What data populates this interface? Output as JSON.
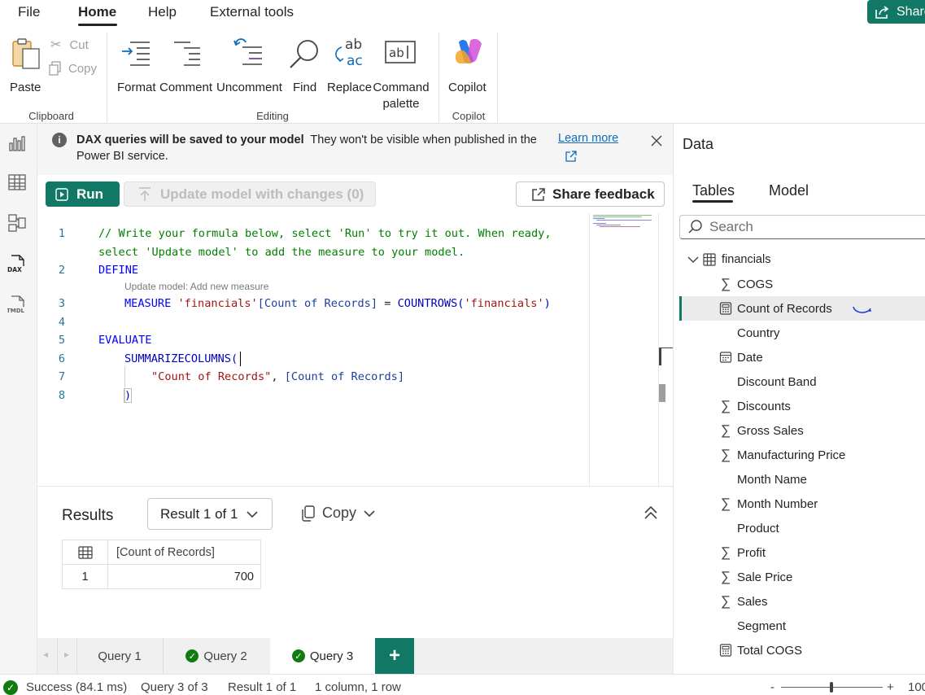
{
  "menu": {
    "tabs": [
      "File",
      "Home",
      "Help",
      "External tools"
    ],
    "share": "Share"
  },
  "ribbon": {
    "paste": "Paste",
    "cut": "Cut",
    "copy": "Copy",
    "clipboard_group": "Clipboard",
    "format": "Format",
    "comment": "Comment",
    "uncomment": "Uncomment",
    "find": "Find",
    "replace": "Replace",
    "command_palette_1": "Command",
    "command_palette_2": "palette",
    "editing_group": "Editing",
    "copilot": "Copilot",
    "copilot_group": "Copilot"
  },
  "banner": {
    "bold": "DAX queries will be saved to your model",
    "text": "They won't be visible when published in the Power BI service.",
    "learn_more": "Learn more"
  },
  "toolbar": {
    "run": "Run",
    "update": "Update model with changes (0)",
    "feedback": "Share feedback"
  },
  "editor": {
    "line_numbers": [
      "1",
      "2",
      "3",
      "4",
      "5",
      "6",
      "7",
      "8"
    ],
    "comment_1": "// Write your formula below, select 'Run' to try it out. When ready,",
    "comment_2": "select 'Update model' to add the measure to your model.",
    "define": "DEFINE",
    "hint": "Update model: Add new measure",
    "measure_kw": "MEASURE",
    "measure_table": "'financials'",
    "measure_name": "[Count of Records]",
    "measure_eq": " = ",
    "measure_fn": "COUNTROWS(",
    "measure_arg": "'financials'",
    "measure_close": ")",
    "evaluate": "EVALUATE",
    "summarize": "SUMMARIZECOLUMNS(",
    "string": "\"Count of Records\"",
    "comma": ", ",
    "ref": "[Count of Records]",
    "close": ")"
  },
  "results": {
    "title": "Results",
    "selector": "Result 1 of 1",
    "copy": "Copy",
    "column": "[Count of Records]",
    "rows": [
      {
        "num": "1",
        "value": "700"
      }
    ]
  },
  "query_tabs": {
    "q1": "Query 1",
    "q2": "Query 2",
    "q3": "Query 3",
    "add": "+"
  },
  "status": {
    "success": "Success (84.1 ms)",
    "query": "Query 3 of 3",
    "result": "Result 1 of 1",
    "shape": "1 column, 1 row",
    "zoom_minus": "-",
    "zoom_plus": "+",
    "zoom": "100"
  },
  "data_pane": {
    "title": "Data",
    "tab_tables": "Tables",
    "tab_model": "Model",
    "search_placeholder": "Search",
    "table_name": "financials",
    "fields": [
      {
        "label": "COGS",
        "icon": "sigma"
      },
      {
        "label": "Count of Records",
        "icon": "calculator"
      },
      {
        "label": "Country",
        "icon": ""
      },
      {
        "label": "Date",
        "icon": "calendar"
      },
      {
        "label": "Discount Band",
        "icon": ""
      },
      {
        "label": "Discounts",
        "icon": "sigma"
      },
      {
        "label": "Gross Sales",
        "icon": "sigma"
      },
      {
        "label": "Manufacturing Price",
        "icon": "sigma"
      },
      {
        "label": "Month Name",
        "icon": ""
      },
      {
        "label": "Month Number",
        "icon": "sigma"
      },
      {
        "label": "Product",
        "icon": ""
      },
      {
        "label": "Profit",
        "icon": "sigma"
      },
      {
        "label": "Sale Price",
        "icon": "sigma"
      },
      {
        "label": "Sales",
        "icon": "sigma"
      },
      {
        "label": "Segment",
        "icon": ""
      },
      {
        "label": "Total COGS",
        "icon": "calculator"
      }
    ]
  },
  "colors": {
    "accent": "#117865",
    "link": "#0f6cbd",
    "success": "#107c10"
  }
}
